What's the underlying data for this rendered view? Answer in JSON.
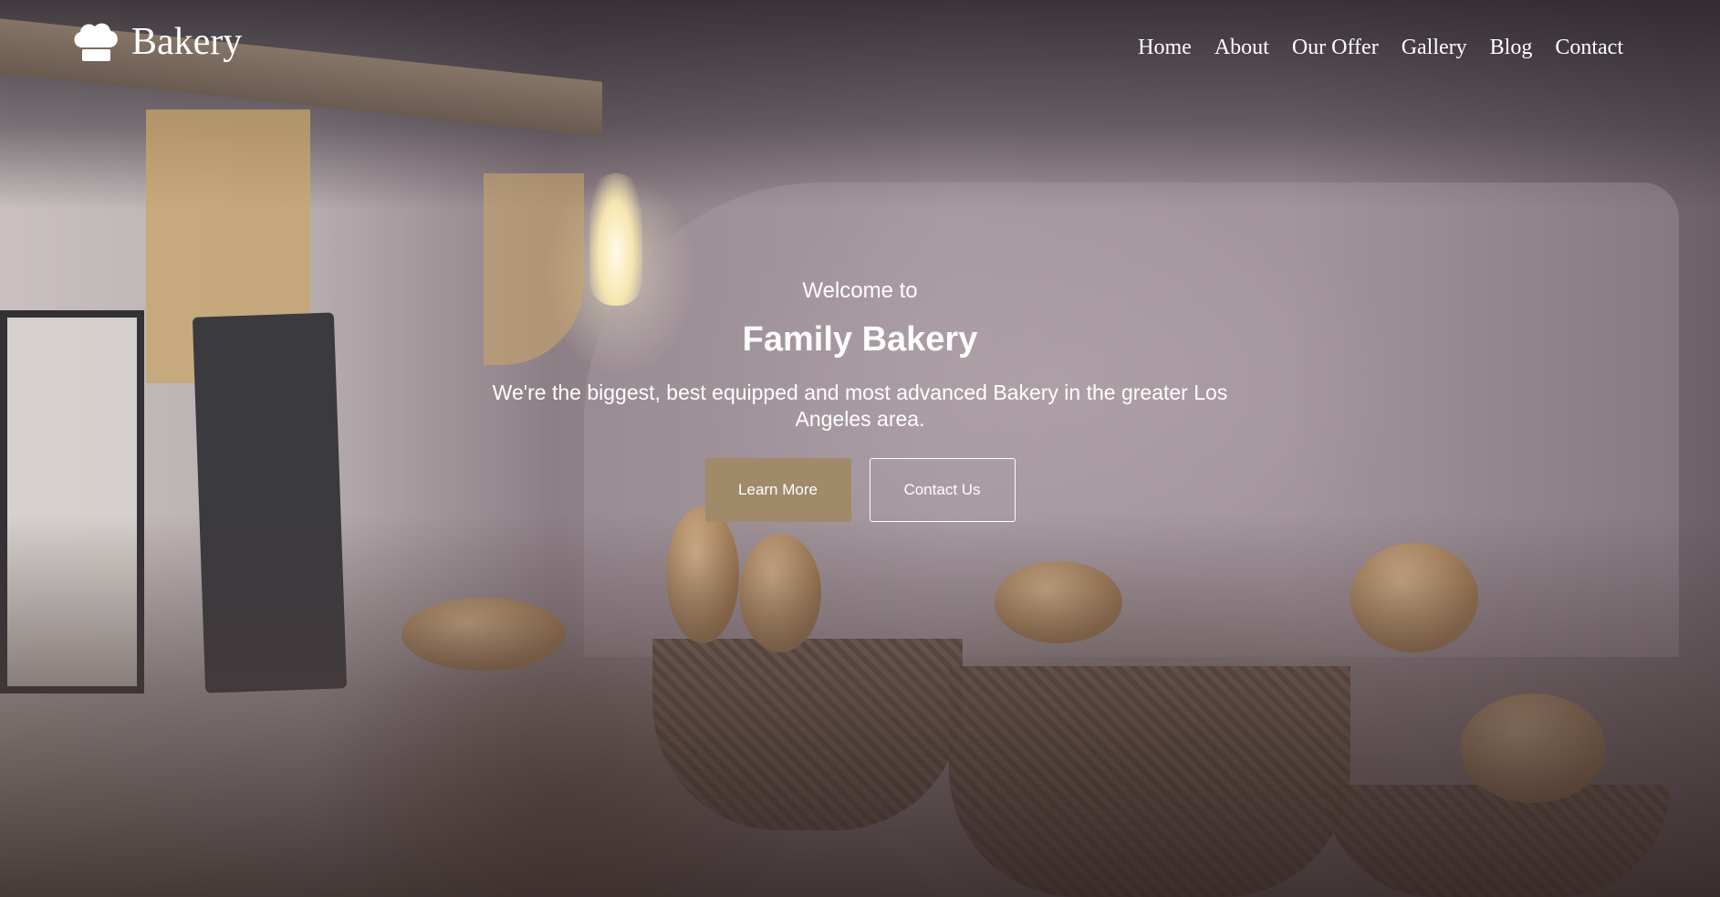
{
  "brand": {
    "logo_text": "Bakery",
    "logo_icon": "chef-hat-icon"
  },
  "nav": {
    "items": [
      {
        "label": "Home"
      },
      {
        "label": "About"
      },
      {
        "label": "Our Offer"
      },
      {
        "label": "Gallery"
      },
      {
        "label": "Blog"
      },
      {
        "label": "Contact"
      }
    ]
  },
  "hero": {
    "kicker": "Welcome to",
    "title": "Family Bakery",
    "description": "We're the biggest, best equipped and most advanced Bakery in the greater Los Angeles area.",
    "primary_button": "Learn More",
    "secondary_button": "Contact Us",
    "background": "bakery-interior-photo"
  },
  "colors": {
    "accent": "#a08a6a",
    "text": "#ffffff"
  }
}
